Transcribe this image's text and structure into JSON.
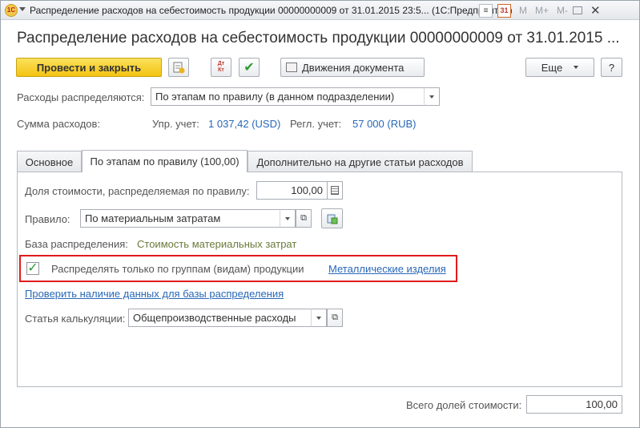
{
  "window": {
    "title": "Распределение расходов на себестоимость продукции 00000000009 от 31.01.2015 23:5... (1С:Предприятие)",
    "app_logo": "1С",
    "controls": [
      "M",
      "M+",
      "M-"
    ]
  },
  "header": {
    "page_title": "Распределение расходов на себестоимость продукции 00000000009 от 31.01.2015 ..."
  },
  "toolbar": {
    "post_close_label": "Провести и закрыть",
    "dtkt_label": "Дт Кт",
    "movements_label": "Движения документа",
    "more_label": "Еще",
    "help_label": "?"
  },
  "form": {
    "distribution_label": "Расходы распределяются:",
    "distribution_value": "По этапам по правилу (в данном подразделении)",
    "sum_label": "Сумма расходов:",
    "mgmt_label": "Упр. учет:",
    "mgmt_value": "1 037,42 (USD)",
    "reg_label": "Регл. учет:",
    "reg_value": "57 000 (RUB)"
  },
  "tabs": [
    {
      "label": "Основное"
    },
    {
      "label": "По этапам по правилу (100,00)"
    },
    {
      "label": "Дополнительно на другие статьи расходов"
    }
  ],
  "panel": {
    "share_label": "Доля стоимости, распределяемая по правилу:",
    "share_value": "100,00",
    "rule_label": "Правило:",
    "rule_value": "По материальным затратам",
    "base_label": "База распределения:",
    "base_value": "Стоимость материальных затрат",
    "group_checkbox_label": "Распределять только по группам (видам) продукции",
    "group_link": "Металлические изделия",
    "check_data_link": "Проверить наличие данных для базы распределения",
    "calc_label": "Статья калькуляции:",
    "calc_value": "Общепроизводственные расходы"
  },
  "footer": {
    "total_label": "Всего долей стоимости:",
    "total_value": "100,00"
  }
}
